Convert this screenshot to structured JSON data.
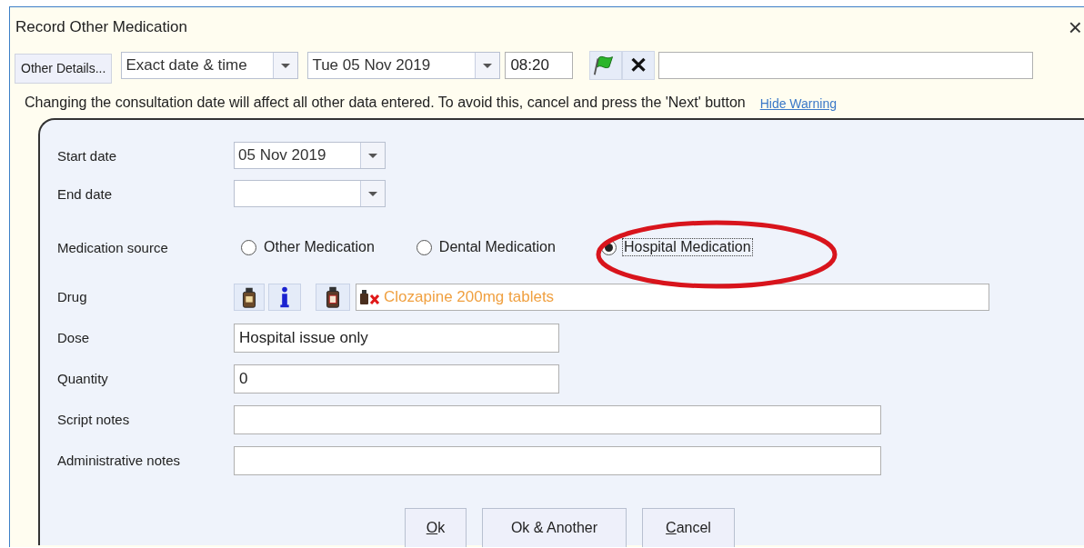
{
  "window": {
    "title": "Record Other Medication",
    "close": "×"
  },
  "toolbar": {
    "other_details": "Other Details...",
    "date_mode": "Exact date & time",
    "date": "Tue 05 Nov 2019",
    "time": "08:20",
    "clear": "✕"
  },
  "warning": {
    "text": "Changing the consultation date will affect all other data entered. To avoid this, cancel and press the 'Next' button",
    "link": "Hide Warning"
  },
  "form": {
    "start_date": {
      "label": "Start date",
      "value": "05 Nov 2019"
    },
    "end_date": {
      "label": "End date"
    },
    "medication_source": {
      "label": "Medication source",
      "options": [
        {
          "label": "Other Medication",
          "selected": false
        },
        {
          "label": "Dental Medication",
          "selected": false
        },
        {
          "label": "Hospital Medication",
          "selected": true
        }
      ]
    },
    "drug": {
      "label": "Drug",
      "value": "Clozapine 200mg tablets"
    },
    "fields": [
      {
        "label": "Dose",
        "value": "Hospital issue only",
        "kind": "short"
      },
      {
        "label": "Quantity",
        "value": "0",
        "kind": "short"
      },
      {
        "label": "Script notes",
        "kind": "long"
      },
      {
        "label": "Administrative notes",
        "kind": "long"
      }
    ]
  },
  "buttons": [
    "Ok",
    "Ok & Another",
    "Cancel"
  ]
}
